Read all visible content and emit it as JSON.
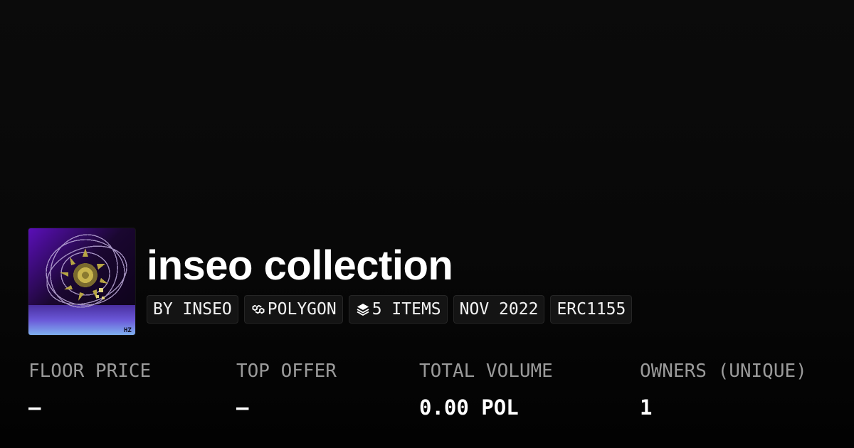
{
  "collection": {
    "name": "inseo collection",
    "image_alt": "inseo collection image",
    "image_signature": "HZ"
  },
  "badges": [
    {
      "label": "BY INSEO",
      "icon": null
    },
    {
      "label": "POLYGON",
      "icon": "polygon-icon"
    },
    {
      "label": "5 ITEMS",
      "icon": "layers-icon"
    },
    {
      "label": "NOV 2022",
      "icon": null
    },
    {
      "label": "ERC1155",
      "icon": null
    }
  ],
  "stats": {
    "floor_price": {
      "label": "FLOOR PRICE",
      "value": "–"
    },
    "top_offer": {
      "label": "TOP OFFER",
      "value": "–"
    },
    "total_volume": {
      "label": "TOTAL VOLUME",
      "value": "0.00 POL"
    },
    "owners": {
      "label": "OWNERS (UNIQUE)",
      "value": "1"
    }
  },
  "colors": {
    "background": "#0a0a0a",
    "badge_background": "#141414",
    "label_gray": "#9a9a9a",
    "text_white": "#ffffff"
  }
}
